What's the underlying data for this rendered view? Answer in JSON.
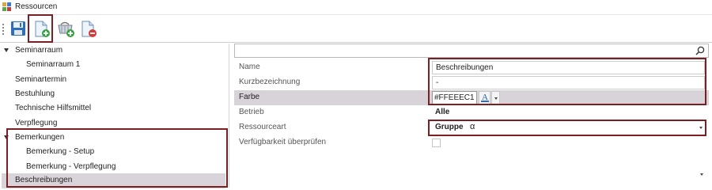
{
  "window": {
    "title": "Ressourcen",
    "icon": "app-grid-icon",
    "icon_colors": [
      "#e8a23a",
      "#3a7bd5",
      "#5aa846",
      "#c93a3a"
    ]
  },
  "toolbar": {
    "buttons": [
      {
        "name": "save-button",
        "icon": "floppy-disk-icon"
      },
      {
        "name": "new-resource-button",
        "icon": "new-document-icon",
        "highlighted": true
      },
      {
        "name": "add-basket-button",
        "icon": "basket-add-icon"
      },
      {
        "name": "remove-resource-button",
        "icon": "delete-document-icon"
      }
    ]
  },
  "tree": {
    "items": [
      {
        "label": "Seminarraum",
        "expanded": true
      },
      {
        "label": "Seminarraum 1"
      },
      {
        "label": "Seminartermin"
      },
      {
        "label": "Bestuhlung"
      },
      {
        "label": "Technische Hilfsmittel"
      },
      {
        "label": "Verpflegung"
      },
      {
        "label": "Bemerkungen",
        "expanded": true
      },
      {
        "label": "Bemerkung - Setup"
      },
      {
        "label": "Bemerkung - Verpflegung"
      },
      {
        "label": "Beschreibungen",
        "selected": true
      }
    ]
  },
  "properties": {
    "search_placeholder": "",
    "rows": [
      {
        "label": "Name",
        "value": "Beschreibungen"
      },
      {
        "label": "Kurzbezeichnung",
        "value": "-"
      },
      {
        "label": "Farbe",
        "value": "#FFEEEC1",
        "selected": true
      },
      {
        "label": "Betrieb",
        "value": "Alle"
      },
      {
        "label": "Ressourceart",
        "value": "Gruppe",
        "extra": "α"
      },
      {
        "label": "Verfügbarkeit überprüfen",
        "checked": false
      }
    ]
  },
  "colors": {
    "highlight_frame": "#7a1f24",
    "selection": "#d9d4da",
    "accent_blue": "#2a6bd0",
    "add_green": "#3aa043",
    "remove_red": "#d23a3a"
  }
}
